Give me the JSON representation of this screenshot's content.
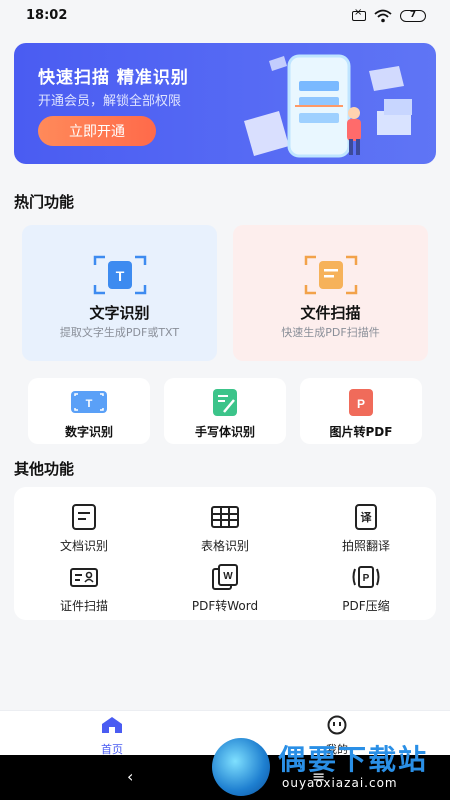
{
  "status_bar": {
    "time": "18:02",
    "battery": "7"
  },
  "banner": {
    "title": "快速扫描  精准识别",
    "subtitle": "开通会员，解锁全部权限",
    "button_label": "立即开通"
  },
  "hot_section": {
    "title": "热门功能",
    "big_cards": [
      {
        "title": "文字识别",
        "desc": "提取文字生成PDF或TXT"
      },
      {
        "title": "文件扫描",
        "desc": "快速生成PDF扫描件"
      }
    ],
    "small_cards": [
      {
        "label": "数字识别"
      },
      {
        "label": "手写体识别"
      },
      {
        "label": "图片转PDF"
      }
    ]
  },
  "other_section": {
    "title": "其他功能",
    "items": [
      {
        "label": "文档识别"
      },
      {
        "label": "表格识别"
      },
      {
        "label": "拍照翻译"
      },
      {
        "label": "证件扫描"
      },
      {
        "label": "PDF转Word"
      },
      {
        "label": "PDF压缩"
      }
    ]
  },
  "tabbar": {
    "tabs": [
      {
        "label": "首页"
      },
      {
        "label": "我的"
      }
    ],
    "active_color": "#4a5cf2"
  },
  "watermark": {
    "title": "偶要下载站",
    "url": "ouyaoxiazai.com"
  },
  "colors": {
    "brand_blue": "#4a5cf2",
    "banner_button": "#ff7a52",
    "card_blue_bg": "#e8f1fd",
    "card_pink_bg": "#fdeeed"
  }
}
